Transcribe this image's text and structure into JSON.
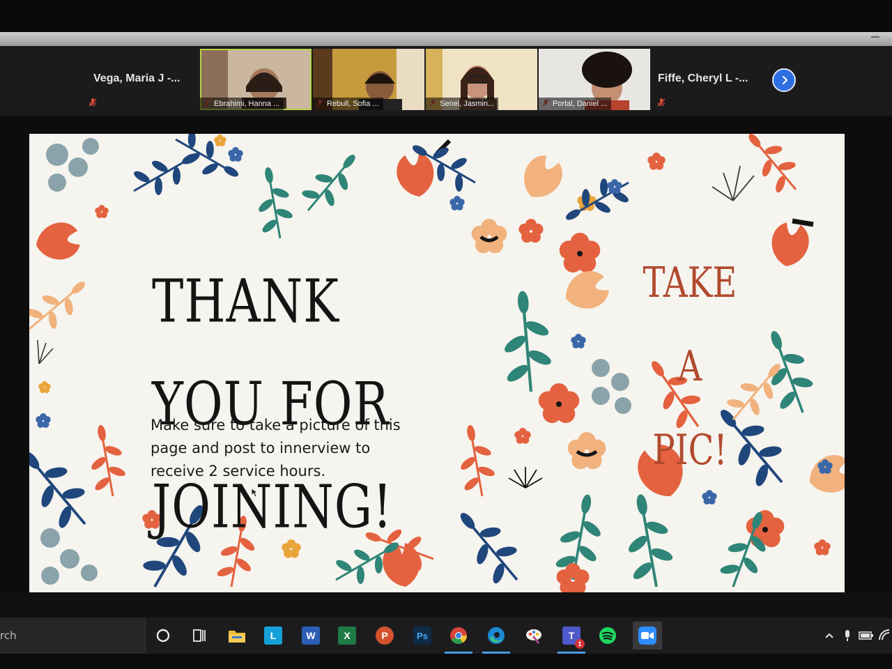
{
  "participants": {
    "left_name": "Vega, Maria J -...",
    "right_name": "Fiffe, Cheryl L -...",
    "video_tiles": [
      {
        "caption": "Ebrahimi, Hanna ..."
      },
      {
        "caption": "Rebull, Sofia ..."
      },
      {
        "caption": "Senel, Jasmin..."
      },
      {
        "caption": "Portal, Daniel ..."
      }
    ],
    "next_icon": "chevron-right-icon"
  },
  "slide": {
    "title_line1": "THANK YOU FOR",
    "title_line2": "JOINING!",
    "body": "Make sure to take a picture of this page and post to innerview to receive 2 service hours.",
    "aside_line1": "TAKE A",
    "aside_line2": "PIC!"
  },
  "taskbar": {
    "search_text": "rch",
    "icons": [
      "cortana-icon",
      "task-view-icon",
      "file-explorer-icon",
      "l-app-icon",
      "word-icon",
      "excel-icon",
      "powerpoint-icon",
      "photoshop-icon",
      "chrome-icon",
      "edge-icon",
      "paint-icon",
      "teams-icon",
      "spotify-icon",
      "zoom-icon"
    ],
    "teams_badge": "1",
    "tray": [
      "chevron-up-icon",
      "microphone-icon",
      "battery-icon",
      "wifi-icon"
    ]
  },
  "colors": {
    "slide_bg": "#f6f4ef",
    "accent_orange": "#e4623f",
    "accent_navy": "#20477c",
    "accent_teal": "#2f8577",
    "accent_peach": "#f1b27d",
    "aside_text": "#b14a2e",
    "zoom_blue": "#2d6fe0"
  }
}
